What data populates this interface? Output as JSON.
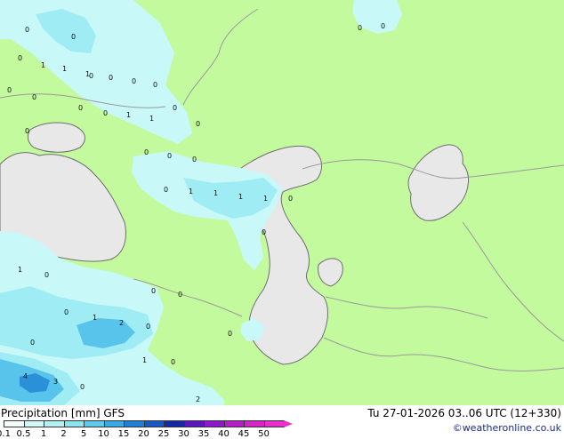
{
  "map": {
    "colors": {
      "land": "#c4fa9e",
      "sea": "#e8e8e8",
      "precip_light": "#c8f8f8",
      "precip_mid": "#a0ecf4",
      "precip_heavy": "#58c4ec",
      "precip_strong": "#2a90d8",
      "border": "#9a9a9a",
      "coast": "#6e6e6e"
    },
    "point_labels": [
      "0",
      "0",
      "0",
      "0",
      "0",
      "0",
      "0",
      "1",
      "1",
      "1",
      "0",
      "0",
      "0",
      "0",
      "0",
      "0",
      "1",
      "1",
      "0",
      "0",
      "0",
      "0",
      "0",
      "1",
      "1",
      "1",
      "1",
      "0",
      "0",
      "0",
      "0",
      "1",
      "0",
      "0",
      "0",
      "0",
      "1",
      "2",
      "0",
      "0",
      "1",
      "0",
      "4",
      "3",
      "0",
      "2",
      "0"
    ]
  },
  "footer": {
    "title": "Precipitation [mm]  GFS",
    "run_info": "Tu 27-01-2026 03..06 UTC (12+330)",
    "credit": "©weatheronline.co.uk",
    "scale_ticks": [
      "0.1",
      "0.5",
      "1",
      "2",
      "5",
      "10",
      "15",
      "20",
      "25",
      "30",
      "35",
      "40",
      "45",
      "50"
    ],
    "scale_colors": [
      "#f4fcfc",
      "#d4f8f8",
      "#b4f0f4",
      "#8ce4f0",
      "#5ccaec",
      "#3aa8e4",
      "#2080d8",
      "#1a58c8",
      "#1428a8",
      "#5e14c0",
      "#8e18cc",
      "#b81ec8",
      "#d624c8",
      "#e830cc"
    ]
  }
}
